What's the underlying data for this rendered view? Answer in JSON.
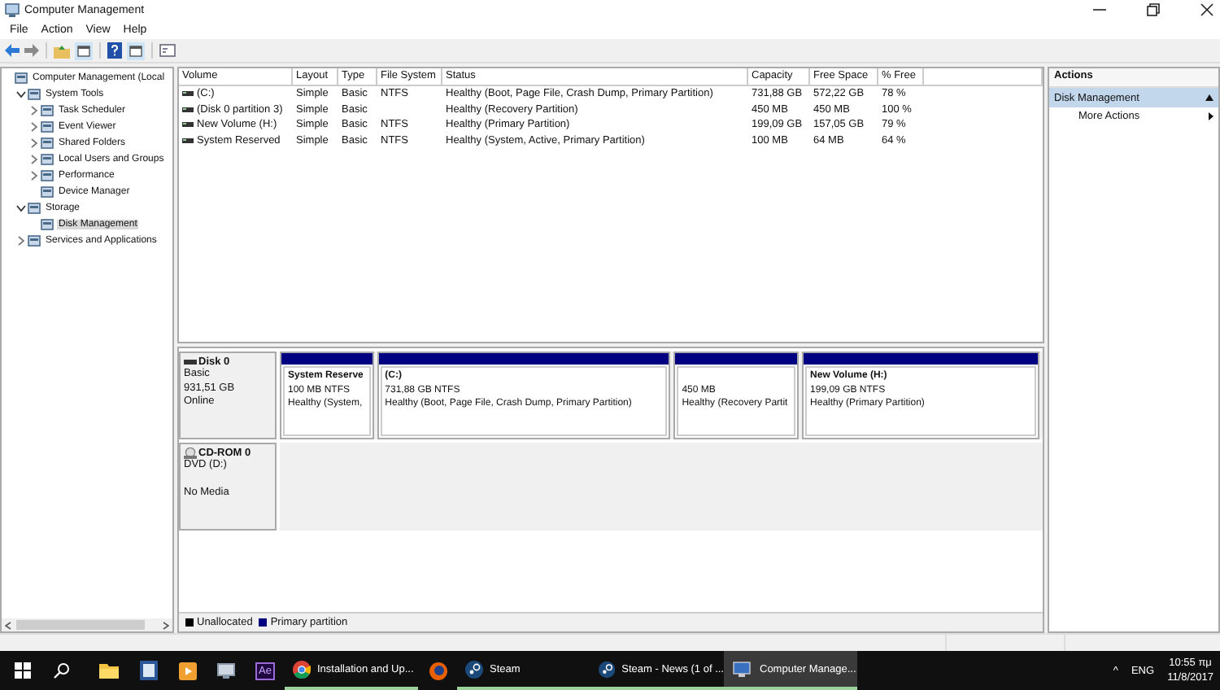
{
  "window": {
    "title": "Computer Management"
  },
  "menu": [
    "File",
    "Action",
    "View",
    "Help"
  ],
  "tree": [
    {
      "label": "Computer Management (Local",
      "selected": false,
      "children": [
        {
          "label": "System Tools",
          "expanded": true,
          "selected": false,
          "children": [
            {
              "label": "Task Scheduler",
              "expanded": false,
              "selected": false
            },
            {
              "label": "Event Viewer",
              "expanded": false,
              "selected": false
            },
            {
              "label": "Shared Folders",
              "expanded": false,
              "selected": false
            },
            {
              "label": "Local Users and Groups",
              "expanded": false,
              "selected": false
            },
            {
              "label": "Performance",
              "expanded": false,
              "selected": false
            },
            {
              "label": "Device Manager",
              "selected": false
            }
          ]
        },
        {
          "label": "Storage",
          "expanded": true,
          "selected": false,
          "children": [
            {
              "label": "Disk Management",
              "selected": true
            }
          ]
        },
        {
          "label": "Services and Applications",
          "expanded": false,
          "selected": false
        }
      ]
    }
  ],
  "table": {
    "columns": [
      "Volume",
      "Layout",
      "Type",
      "File System",
      "Status",
      "Capacity",
      "Free Space",
      "% Free"
    ],
    "rows": [
      [
        "(C:)",
        "Simple",
        "Basic",
        "NTFS",
        "Healthy (Boot, Page File, Crash Dump, Primary Partition)",
        "731,88 GB",
        "572,22 GB",
        "78 %"
      ],
      [
        "(Disk 0 partition 3)",
        "Simple",
        "Basic",
        "",
        "Healthy (Recovery Partition)",
        "450 MB",
        "450 MB",
        "100 %"
      ],
      [
        "New Volume (H:)",
        "Simple",
        "Basic",
        "NTFS",
        "Healthy (Primary Partition)",
        "199,09 GB",
        "157,05 GB",
        "79 %"
      ],
      [
        "System Reserved",
        "Simple",
        "Basic",
        "NTFS",
        "Healthy (System, Active, Primary Partition)",
        "100 MB",
        "64 MB",
        "64 %"
      ]
    ]
  },
  "disks": [
    {
      "kind": "hdd",
      "name": "Disk 0",
      "lines": [
        "Basic",
        "931,51 GB",
        "Online"
      ],
      "partitions": [
        {
          "title": "System Reserve",
          "size": "100 MB NTFS",
          "status": "Healthy (System,",
          "color": "#000080"
        },
        {
          "title": "(C:)",
          "size": "731,88 GB NTFS",
          "status": "Healthy (Boot, Page File, Crash Dump, Primary Partition)",
          "color": "#000080"
        },
        {
          "size": "450 MB",
          "status": "Healthy (Recovery Partit",
          "color": "#000080"
        },
        {
          "title": "New Volume  (H:)",
          "size": "199,09 GB NTFS",
          "status": "Healthy (Primary Partition)",
          "color": "#000080"
        }
      ]
    },
    {
      "kind": "cdrom",
      "name": "CD-ROM 0",
      "lines": [
        "DVD (D:)"
      ],
      "note": "No Media"
    }
  ],
  "legend": [
    {
      "label": "Unallocated",
      "color": "#000000"
    },
    {
      "label": "Primary partition",
      "color": "#000080"
    }
  ],
  "actions": {
    "header": "Actions",
    "sections": [
      {
        "title": "Disk Management",
        "selected": true,
        "items": [
          "More Actions"
        ]
      }
    ]
  },
  "taskbar": {
    "apps": [
      {
        "kind": "folder",
        "running": false,
        "selected": false
      },
      {
        "kind": "word",
        "running": false,
        "selected": false
      },
      {
        "kind": "media",
        "running": false,
        "selected": false
      },
      {
        "kind": "network",
        "running": false,
        "selected": false
      },
      {
        "kind": "ae",
        "badge_text": "Ae",
        "running": false,
        "selected": false
      },
      {
        "kind": "chrome",
        "label": "Installation and Up...",
        "running": true,
        "selected": false
      },
      {
        "kind": "firefox",
        "running": false,
        "selected": false
      },
      {
        "kind": "steam",
        "label": "Steam",
        "running": true,
        "selected": false
      },
      {
        "kind": "steam",
        "label": "Steam - News (1 of ...",
        "running": true,
        "selected": false
      },
      {
        "kind": "computer",
        "label": "Computer Manage...",
        "running": true,
        "selected": true
      }
    ],
    "tray_arrow": "^",
    "language": "ENG",
    "time": "10:55 πμ",
    "date": "11/8/2017"
  }
}
